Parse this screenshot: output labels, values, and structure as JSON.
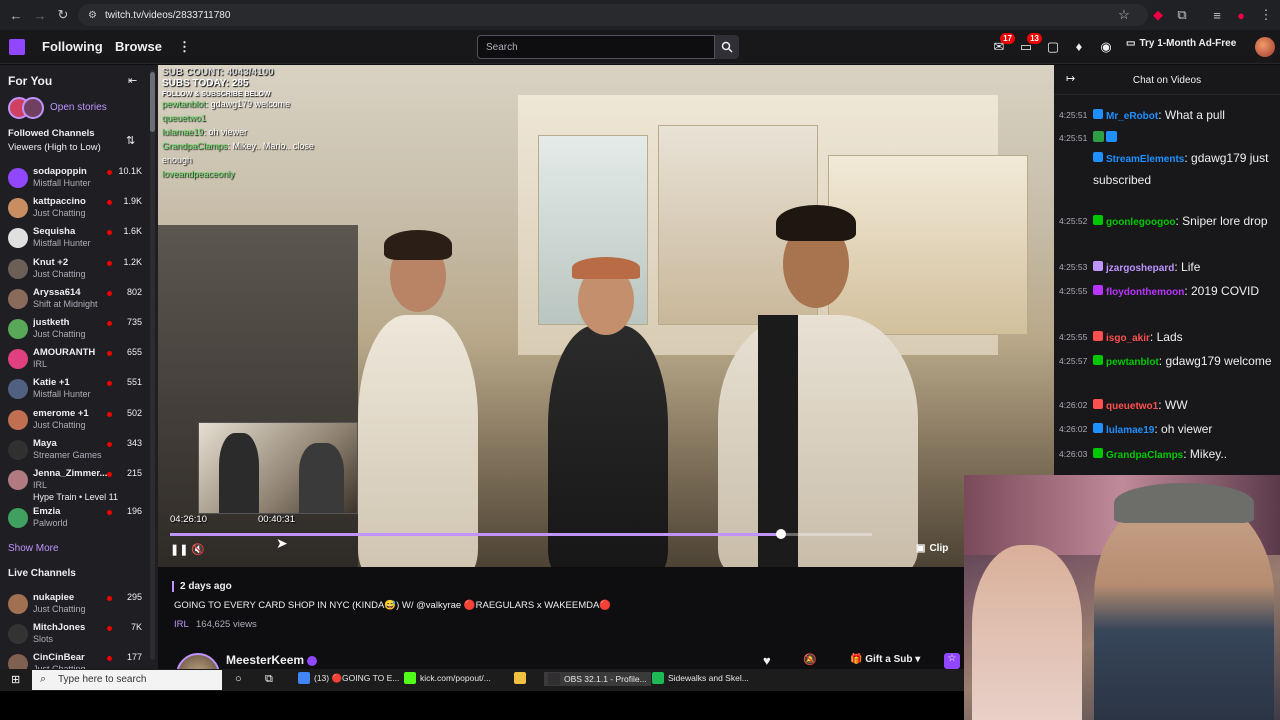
{
  "browser": {
    "url": "twitch.tv/videos/2833711780"
  },
  "nav": {
    "following": "Following",
    "browse": "Browse",
    "search_placeholder": "Search",
    "inbox_badge": "17",
    "notif_badge": "13",
    "adfree": "Try 1-Month Ad-Free"
  },
  "sidebar": {
    "for_you": "For You",
    "open_stories": "Open stories",
    "followed_header": "Followed Channels",
    "followed_sort": "Viewers (High to Low)",
    "show_more": "Show More",
    "live_header": "Live Channels",
    "followed": [
      {
        "name": "sodapoppin",
        "game": "Mistfall Hunter",
        "viewers": "10.1K",
        "color": "#9146ff"
      },
      {
        "name": "kattpaccino",
        "game": "Just Chatting",
        "viewers": "1.9K",
        "color": "#c98d62"
      },
      {
        "name": "Sequisha",
        "game": "Mistfall Hunter",
        "viewers": "1.6K",
        "color": "#e0e0e0"
      },
      {
        "name": "Knut +2",
        "game": "Just Chatting",
        "viewers": "1.2K",
        "color": "#6b5f56"
      },
      {
        "name": "Aryssa614",
        "game": "Shift at Midnight",
        "viewers": "802",
        "color": "#8a6a5a"
      },
      {
        "name": "justketh",
        "game": "Just Chatting",
        "viewers": "735",
        "color": "#58a858"
      },
      {
        "name": "AMOURANTH",
        "game": "IRL",
        "viewers": "655",
        "color": "#e04080"
      },
      {
        "name": "Katie +1",
        "game": "Mistfall Hunter",
        "viewers": "551",
        "color": "#506080"
      },
      {
        "name": "emerome +1",
        "game": "Just Chatting",
        "viewers": "502",
        "color": "#c07050"
      },
      {
        "name": "Maya",
        "game": "Streamer Games",
        "viewers": "343",
        "color": "#303030"
      },
      {
        "name": "Jenna_Zimmer...",
        "game": "IRL",
        "viewers": "215",
        "color": "#b07a80"
      },
      {
        "name": "Emzia",
        "game": "Palworld",
        "viewers": "196",
        "color": "#40a060"
      }
    ],
    "hype_train": "Hype Train • Level 11",
    "live": [
      {
        "name": "nukapiee",
        "game": "Just Chatting",
        "viewers": "295",
        "color": "#a07050"
      },
      {
        "name": "MitchJones",
        "game": "Slots",
        "viewers": "7K",
        "color": "#333333"
      },
      {
        "name": "CinCinBear",
        "game": "Just Chatting",
        "viewers": "177",
        "color": "#806050"
      }
    ]
  },
  "video": {
    "overlay_sub_count": "SUB COUNT: 4043/4100",
    "overlay_subs_today": "SUBS TODAY: 285",
    "overlay_follow": "FOLLOW & SUBSCRIBE BELOW",
    "overlay_chat": [
      {
        "user": "pewtanblot",
        "text": "gdawg179 welcome"
      },
      {
        "user": "queuetwo1",
        "text": ""
      },
      {
        "user": "lulamae19",
        "text": "oh viewer"
      },
      {
        "user": "GrandpaClamps",
        "text": "Mikey.. Mario.. close"
      },
      {
        "user": "",
        "text": "enough"
      },
      {
        "user": "loveandpeaceonly",
        "text": ""
      }
    ],
    "current_time": "04:26:10",
    "preview_time": "00:40:31",
    "progress": 0.87,
    "clip": "Clip"
  },
  "info": {
    "posted": "2 days ago",
    "title": "GOING TO EVERY CARD SHOP IN NYC (KINDA😅) W/ @valkyrae 🔴RAEGULARS x WAKEEMDA🔴",
    "category": "IRL",
    "views": "164,625 views",
    "streamer": "MeesterKeem",
    "gift_sub": "Gift a Sub"
  },
  "chat": {
    "title": "Chat on Videos",
    "messages": [
      {
        "ts": "4:25:51",
        "user": "Mr_eRobot",
        "color": "#1e90ff",
        "text": "What a pull"
      },
      {
        "ts": "4:25:51",
        "user": "",
        "color": "#1e90ff",
        "text": ""
      },
      {
        "ts": "",
        "user": "StreamElements",
        "color": "#1e90ff",
        "text": "gdawg179 just subscribed"
      },
      {
        "ts": "4:25:52",
        "user": "goonlegoogoo",
        "color": "#00c800",
        "text": "Sniper lore drop"
      },
      {
        "ts": "4:25:53",
        "user": "jzargoshepard",
        "color": "#bf94ff",
        "text": "Life"
      },
      {
        "ts": "4:25:55",
        "user": "floydonthemoon",
        "color": "#b934ff",
        "text": "2019 COVID"
      },
      {
        "ts": "4:25:55",
        "user": "isgo_akir",
        "color": "#ff4f4f",
        "text": "Lads"
      },
      {
        "ts": "4:25:57",
        "user": "pewtanblot",
        "color": "#00c800",
        "text": "gdawg179 welcome"
      },
      {
        "ts": "4:26:02",
        "user": "queuetwo1",
        "color": "#ff4f4f",
        "text": "WW"
      },
      {
        "ts": "4:26:02",
        "user": "lulamae19",
        "color": "#1e90ff",
        "text": "oh viewer"
      },
      {
        "ts": "4:26:03",
        "user": "GrandpaClamps",
        "color": "#00c800",
        "text": "Mikey.."
      }
    ]
  },
  "taskbar": {
    "search": "Type here to search",
    "items": [
      {
        "label": "(13) 🔴GOING TO E...",
        "color": "#4285f4"
      },
      {
        "label": "kick.com/popout/...",
        "color": "#53fc18"
      },
      {
        "label": "",
        "color": "#f0c040"
      },
      {
        "label": "OBS 32.1.1 - Profile...",
        "color": "#302e31"
      },
      {
        "label": "Sidewalks and Skel...",
        "color": "#1db954"
      }
    ]
  },
  "colors": {
    "accent": "#9146ff",
    "live": "#eb0400",
    "purple_text": "#bf94ff"
  }
}
